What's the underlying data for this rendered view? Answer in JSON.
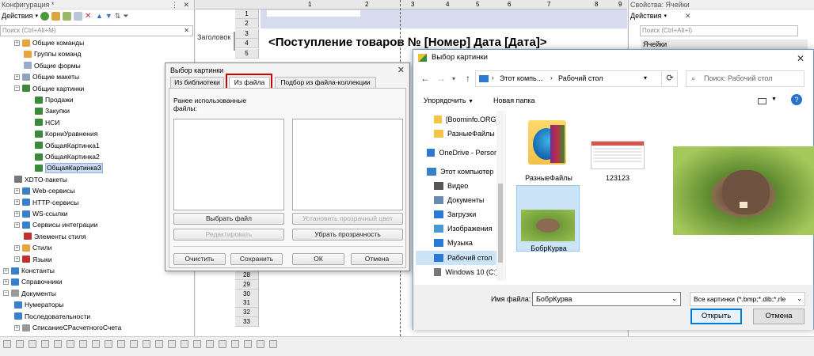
{
  "config_panel": {
    "title": "Конфигурация *",
    "actions_label": "Действия",
    "search_placeholder": "Поиск (Ctrl+Alt+M)",
    "tree": [
      {
        "label": "Общие команды",
        "icon": "commands-icon",
        "color": "#e8a33a"
      },
      {
        "label": "Группы команд",
        "icon": "command-group-icon",
        "color": "#e8a33a"
      },
      {
        "label": "Общие формы",
        "icon": "form-icon",
        "color": "#9aa9c9"
      },
      {
        "label": "Общие макеты",
        "icon": "template-icon",
        "color": "#8da3c0"
      },
      {
        "label": "Общие картинки",
        "icon": "picture-icon",
        "color": "#3a8a3a"
      },
      {
        "label": "Продажи",
        "icon": "picture-icon",
        "color": "#3a8a3a"
      },
      {
        "label": "Закупки",
        "icon": "picture-icon",
        "color": "#3a8a3a"
      },
      {
        "label": "НСИ",
        "icon": "picture-icon",
        "color": "#3a8a3a"
      },
      {
        "label": "КорниУравнения",
        "icon": "picture-icon",
        "color": "#3a8a3a"
      },
      {
        "label": "ОбщаяКартинка1",
        "icon": "picture-icon",
        "color": "#3a8a3a"
      },
      {
        "label": "ОбщаяКартинка2",
        "icon": "picture-icon",
        "color": "#3a8a3a"
      },
      {
        "label": "ОбщаяКартинка3",
        "icon": "picture-icon",
        "color": "#3a8a3a"
      },
      {
        "label": "XDTO-пакеты",
        "icon": "xdto-icon",
        "color": "#777"
      },
      {
        "label": "Web-сервисы",
        "icon": "web-service-icon",
        "color": "#3a7fc9"
      },
      {
        "label": "HTTP-сервисы",
        "icon": "http-service-icon",
        "color": "#3a7fc9"
      },
      {
        "label": "WS-ссылки",
        "icon": "ws-link-icon",
        "color": "#3a7fc9"
      },
      {
        "label": "Сервисы интеграции",
        "icon": "integration-icon",
        "color": "#3a7fc9"
      },
      {
        "label": "Элементы стиля",
        "icon": "style-element-icon",
        "color": "#c03030"
      },
      {
        "label": "Стили",
        "icon": "style-icon",
        "color": "#e8a33a"
      },
      {
        "label": "Языки",
        "icon": "language-icon",
        "color": "#c03030"
      },
      {
        "label": "Константы",
        "icon": "constant-icon",
        "color": "#3a7fc9"
      },
      {
        "label": "Справочники",
        "icon": "catalog-icon",
        "color": "#3a7fc9"
      },
      {
        "label": "Документы",
        "icon": "document-icon",
        "color": "#999"
      },
      {
        "label": "Нумераторы",
        "icon": "numerator-icon",
        "color": "#3a7fc9"
      },
      {
        "label": "Последовательности",
        "icon": "sequence-icon",
        "color": "#3a7fc9"
      },
      {
        "label": "СписаниеСРасчетногоСчета",
        "icon": "document-icon",
        "color": "#999"
      }
    ]
  },
  "spreadsheet": {
    "col_headers": [
      "1",
      "2",
      "3",
      "4",
      "5",
      "6",
      "7",
      "8",
      "9"
    ],
    "row_numbers": [
      "1",
      "2",
      "3",
      "4",
      "5"
    ],
    "row_numbers_bottom": [
      "28",
      "29",
      "30",
      "31",
      "32",
      "33"
    ],
    "header_section_label": "Заголовок",
    "title_text": "<Поступление товаров № [Номер] Дата [Дата]>"
  },
  "properties_panel": {
    "title": "Свойства: Ячейки",
    "actions_label": "Действия",
    "search_placeholder": "Поиск (Ctrl+Alt+I)",
    "section": "Ячейки"
  },
  "picture_dialog": {
    "title": "Выбор картинки",
    "tabs": [
      "Из библиотеки",
      "Из файла",
      "Подбор из файла-коллекции"
    ],
    "active_tab": "Из файла",
    "recent_label": "Ранее использованные файлы:",
    "buttons": {
      "choose_file": "Выбрать файл",
      "set_transparent": "Установить прозрачный цвет",
      "edit": "Редактировать",
      "remove_transparency": "Убрать прозрачность",
      "clear": "Очистить",
      "save": "Сохранить",
      "ok": "ОК",
      "cancel": "Отмена"
    }
  },
  "file_dialog": {
    "title": "Выбор картинки",
    "breadcrumb": [
      "Этот компь...",
      "Рабочий стол"
    ],
    "search_placeholder": "Поиск: Рабочий стол",
    "organize": "Упорядочить",
    "new_folder": "Новая папка",
    "nav": [
      {
        "label": "[Boominfo.ORG]",
        "icon": "folder-icon"
      },
      {
        "label": "РазныеФайлы",
        "icon": "folder-icon"
      },
      {
        "label": "OneDrive - Person",
        "icon": "onedrive-icon"
      },
      {
        "label": "Этот компьютер",
        "icon": "computer-icon"
      },
      {
        "label": "Видео",
        "icon": "video-icon"
      },
      {
        "label": "Документы",
        "icon": "documents-icon"
      },
      {
        "label": "Загрузки",
        "icon": "downloads-icon"
      },
      {
        "label": "Изображения",
        "icon": "pictures-icon"
      },
      {
        "label": "Музыка",
        "icon": "music-icon"
      },
      {
        "label": "Рабочий стол",
        "icon": "desktop-icon"
      },
      {
        "label": "Windows 10 (C:)",
        "icon": "drive-icon"
      }
    ],
    "selected_nav": "Рабочий стол",
    "files": [
      "РазныеФайлы",
      "123123",
      "БобрКурва"
    ],
    "filename_label": "Имя файла:",
    "filename_value": "БобрКурва",
    "filetype_value": "Все картинки (*.bmp;*.dib;*.rle",
    "open_label": "Открыть",
    "cancel_label": "Отмена"
  },
  "colors": {
    "accent": "#0078d7",
    "highlight": "#cc0000",
    "selection": "#cce4f7"
  }
}
